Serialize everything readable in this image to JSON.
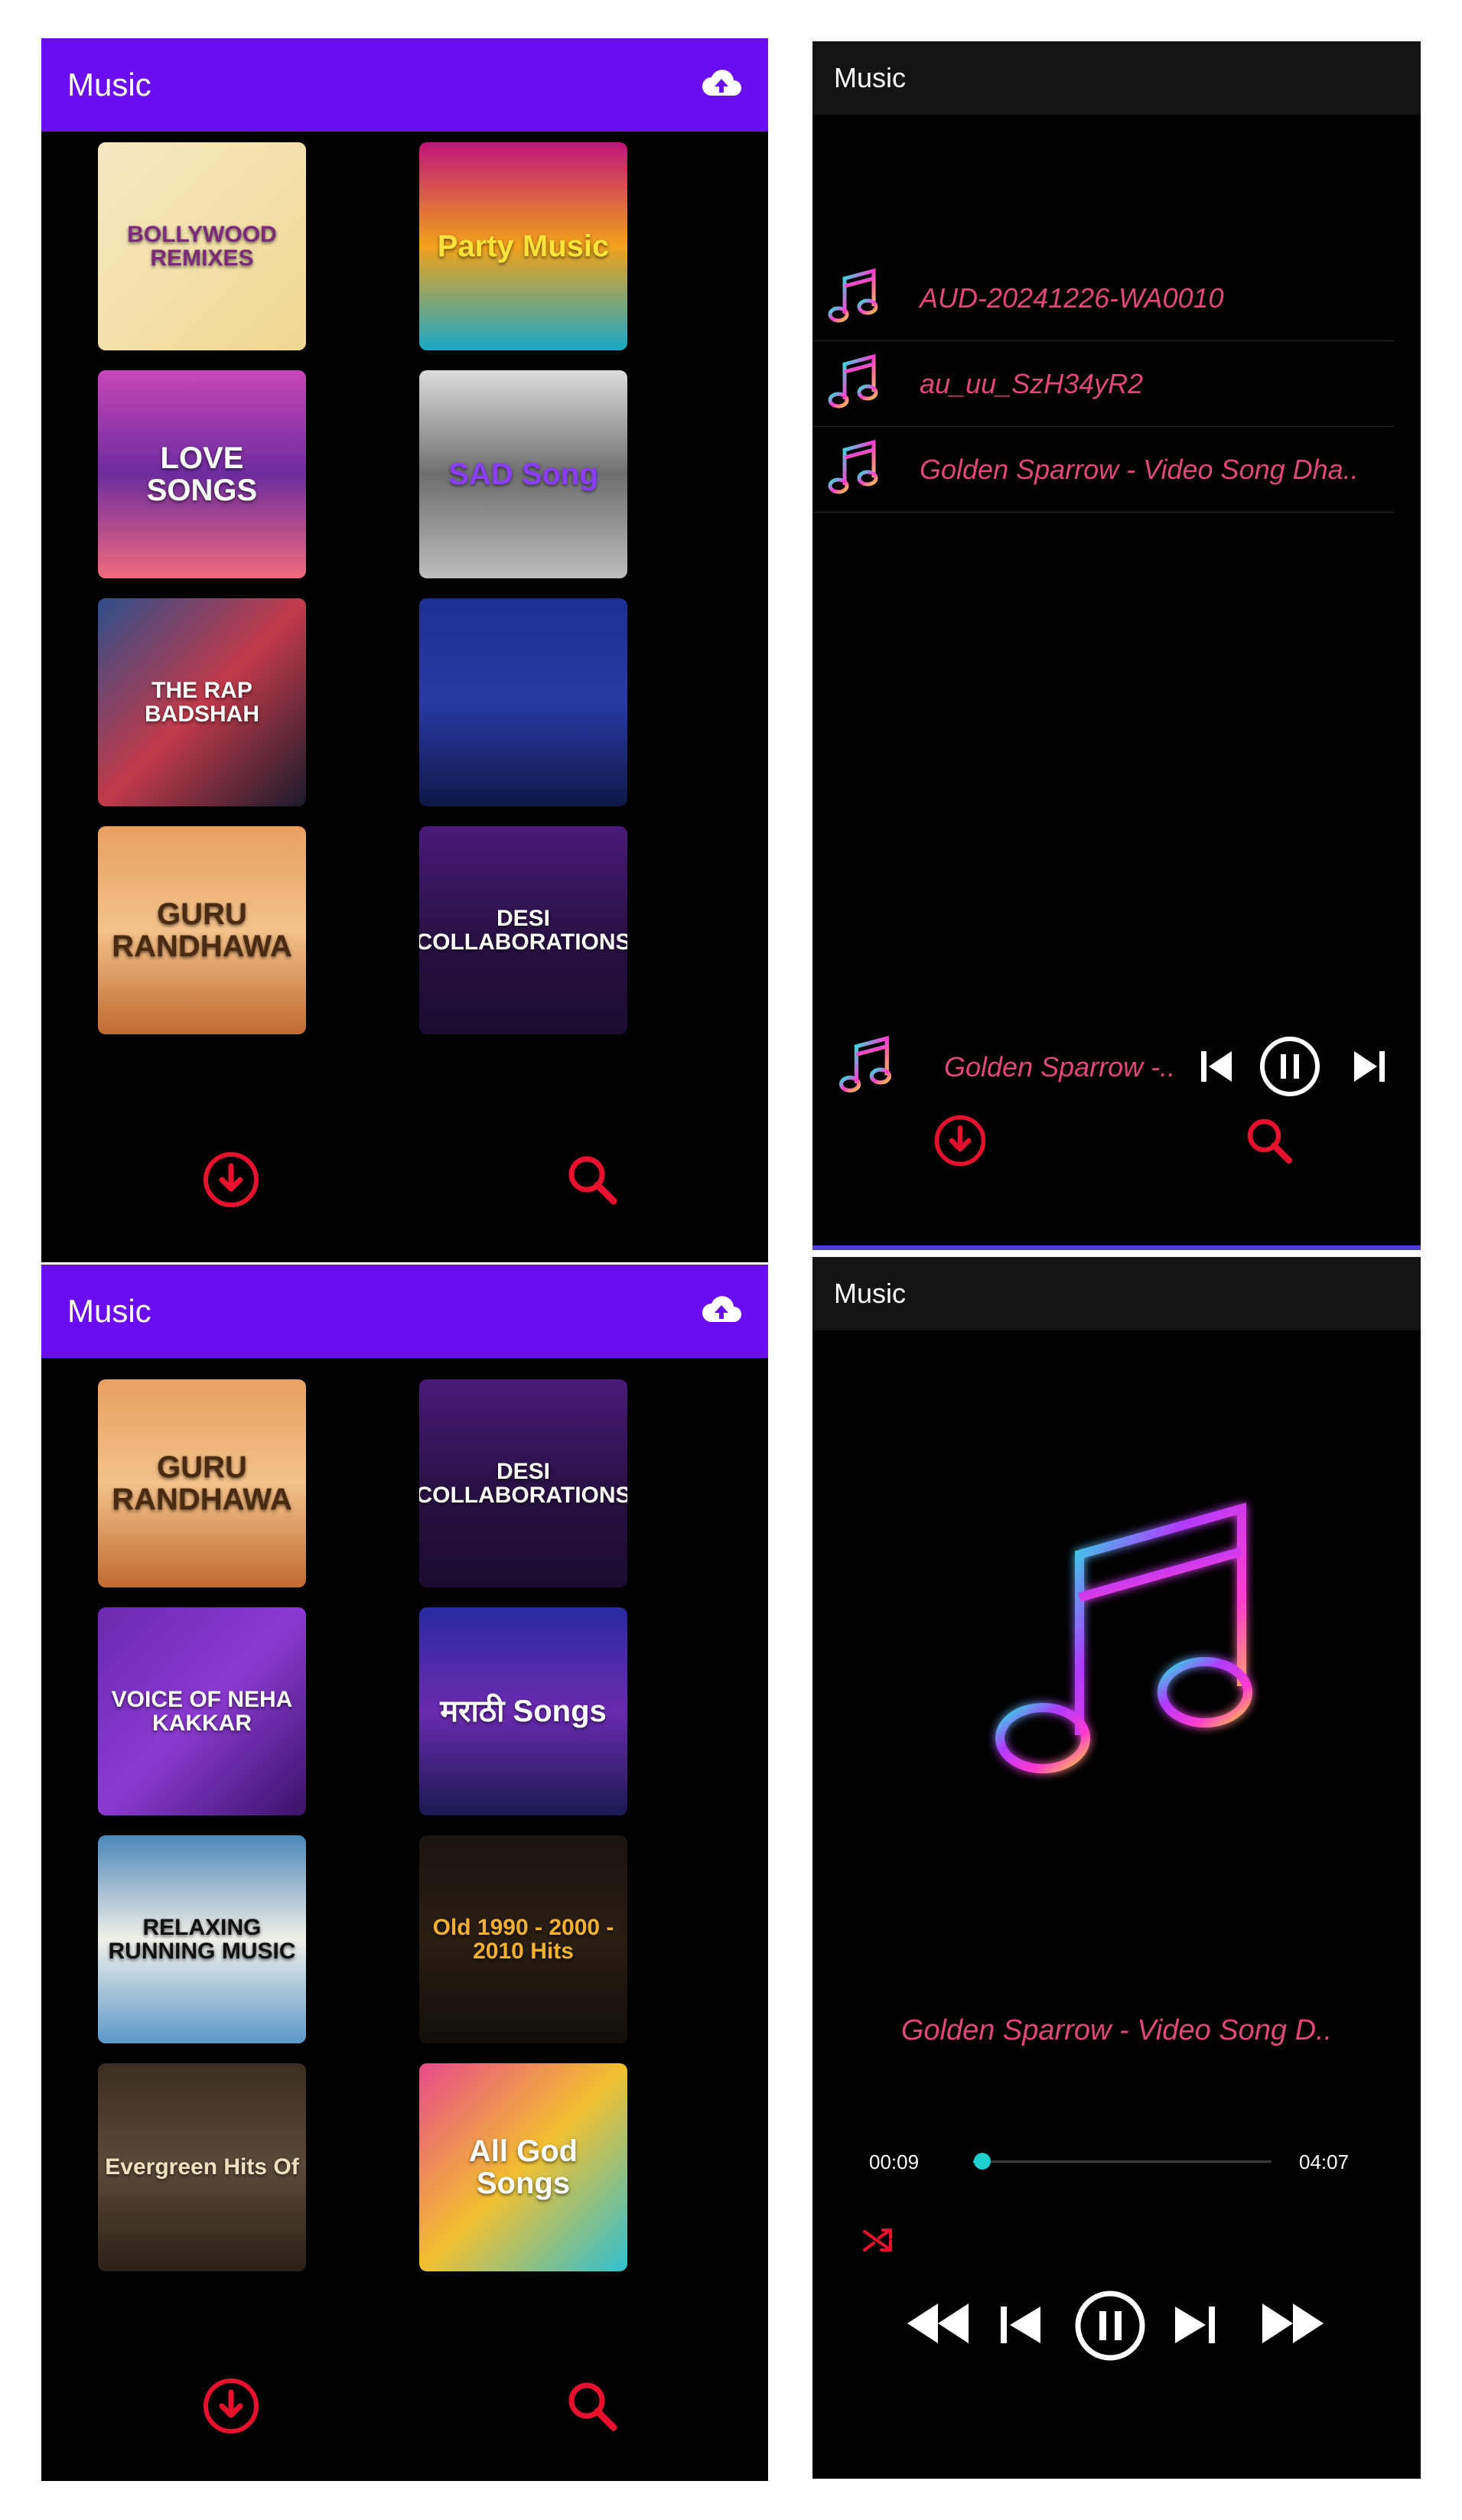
{
  "panel_grid_1": {
    "app_title": "Music",
    "tiles": [
      {
        "label": "BOLLYWOOD REMIXES",
        "bg": "linear-gradient(135deg,#f6e8c4,#f0d890)",
        "color": "#7a2b7a"
      },
      {
        "label": "Party Music",
        "bg": "linear-gradient(180deg,#c0147a,#f2a21a,#19a8c8)",
        "color": "#ffe23a"
      },
      {
        "label": "LOVE SONGS",
        "bg": "linear-gradient(180deg,#c846b8,#6c2c9e,#f06a7c)",
        "color": "#ffffff"
      },
      {
        "label": "SAD Song",
        "bg": "linear-gradient(180deg,#dcdcdc,#6e6e6e,#bdbdbd)",
        "color": "#8a3cff"
      },
      {
        "label": "THE RAP BADSHAH",
        "bg": "linear-gradient(135deg,#2d4f8a,#c23a4a,#1a1a2a)",
        "color": "#ffffff"
      },
      {
        "label": "",
        "bg": "linear-gradient(180deg,#1d2f8e,#283aa6,#0f1746)",
        "color": "#ffffff"
      },
      {
        "label": "GURU RANDHAWA",
        "bg": "linear-gradient(180deg,#e8a060,#f2c28a,#c06a30)",
        "color": "#4a2a10"
      },
      {
        "label": "DESI COLLABORATIONS",
        "bg": "linear-gradient(180deg,#4a1a7a,#2a1246,#1a0c30)",
        "color": "#ffffff"
      }
    ]
  },
  "panel_grid_2": {
    "app_title": "Music",
    "tiles": [
      {
        "label": "GURU RANDHAWA",
        "bg": "linear-gradient(180deg,#e8a060,#f2c28a,#c06a30)",
        "color": "#4a2a10"
      },
      {
        "label": "DESI COLLABORATIONS",
        "bg": "linear-gradient(180deg,#4a1a7a,#2a1246,#1a0c30)",
        "color": "#ffffff"
      },
      {
        "label": "VOICE OF NEHA KAKKAR",
        "bg": "linear-gradient(135deg,#6a2ab0,#8a3ad0,#3a1268)",
        "color": "#ffffff"
      },
      {
        "label": "मराठी Songs",
        "bg": "linear-gradient(180deg,#2a2aa0,#6a2ab0,#1a1a50)",
        "color": "#ffffff"
      },
      {
        "label": "RELAXING RUNNING MUSIC",
        "bg": "linear-gradient(180deg,#4a88b8,#f2f0e8,#5a98c8)",
        "color": "#111111"
      },
      {
        "label": "Old 1990 - 2000 - 2010 Hits",
        "bg": "linear-gradient(180deg,#1a1410,#2a1e12,#120e0a)",
        "color": "#f0b030"
      },
      {
        "label": "Evergreen Hits Of",
        "bg": "linear-gradient(180deg,#3a2e22,#5a4a38,#2a2018)",
        "color": "#f0e0c0"
      },
      {
        "label": "All God Songs",
        "bg": "linear-gradient(135deg,#e84a8a,#f2c030,#30c0d0)",
        "color": "#ffffff"
      }
    ]
  },
  "panel_list": {
    "app_title": "Music",
    "songs": [
      {
        "title": "AUD-20241226-WA0010"
      },
      {
        "title": "au_uu_SzH34yR2"
      },
      {
        "title": "Golden Sparrow - Video Song  Dha.."
      }
    ],
    "mini_player": {
      "title": "Golden Sparrow -.."
    }
  },
  "panel_player": {
    "app_title": "Music",
    "now_playing": "Golden Sparrow - Video Song  D..",
    "elapsed": "00:09",
    "duration": "04:07",
    "progress": 0.03
  },
  "colors": {
    "accent_red": "#e8112d",
    "title_pink": "#e04878",
    "toolbar_purple": "#6a0df0",
    "seek_cyan": "#1fd0d0"
  },
  "icons": {
    "upload": "cloud-upload-icon",
    "download": "download-circle-icon",
    "search": "search-icon",
    "music_note": "music-note-icon",
    "shuffle": "shuffle-icon",
    "prev": "skip-previous-icon",
    "pause": "pause-circle-icon",
    "next": "skip-next-icon",
    "rewind": "fast-rewind-icon",
    "forward": "fast-forward-icon"
  }
}
